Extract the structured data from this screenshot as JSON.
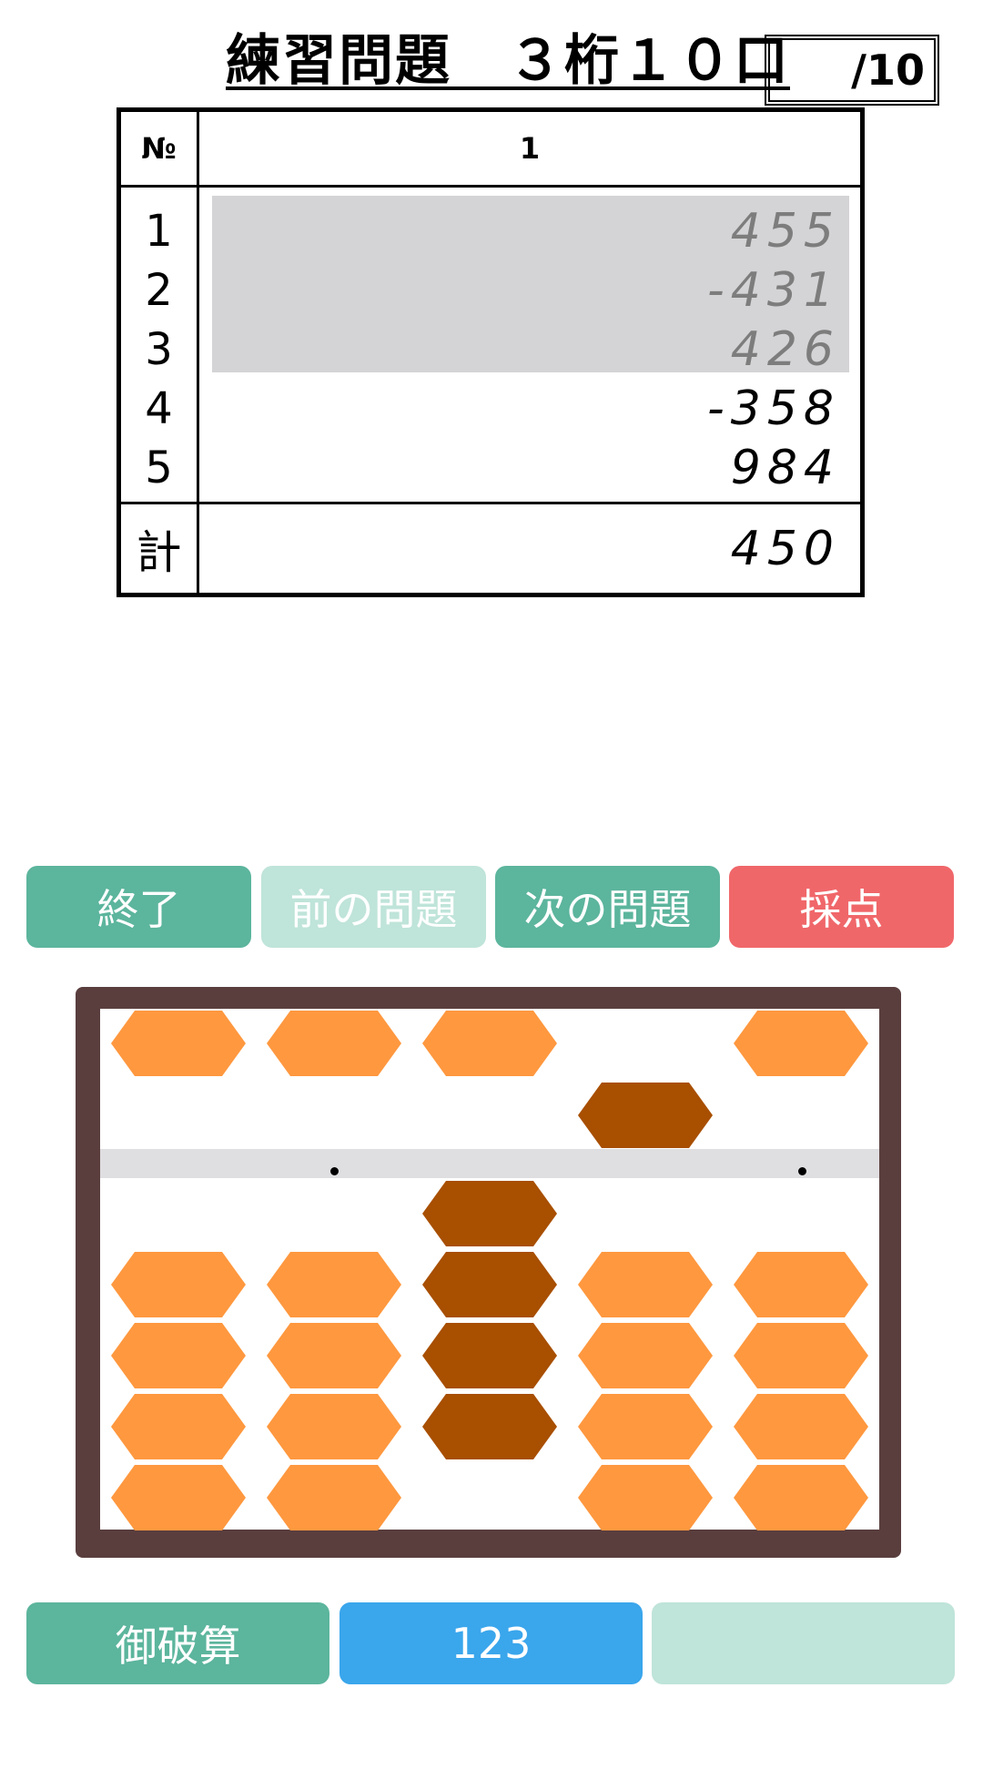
{
  "header": {
    "title": "練習問題　３桁１０口",
    "progress": "/10"
  },
  "table": {
    "no_label": "№",
    "problem_number": "1",
    "rows": [
      {
        "index": "1",
        "value": "455",
        "dim": true
      },
      {
        "index": "2",
        "value": "-431",
        "dim": true
      },
      {
        "index": "3",
        "value": "426",
        "dim": true
      },
      {
        "index": "4",
        "value": "-358",
        "dim": false
      },
      {
        "index": "5",
        "value": "984",
        "dim": false
      }
    ],
    "total_label": "計",
    "total_value": "450"
  },
  "actions": {
    "end": "終了",
    "prev": "前の問題",
    "next": "次の問題",
    "grade": "採点"
  },
  "abacus": {
    "rods": 5,
    "colors": {
      "inactive": "#ff983f",
      "active": "#a84f00",
      "frame": "#5a3e3e",
      "beam": "#dfdee0"
    },
    "heaven_active": [
      false,
      false,
      false,
      true,
      false
    ],
    "earth_active_counts": [
      0,
      0,
      4,
      0,
      0
    ]
  },
  "bottom": {
    "clear": "御破算",
    "mode": "123",
    "blank": ""
  }
}
